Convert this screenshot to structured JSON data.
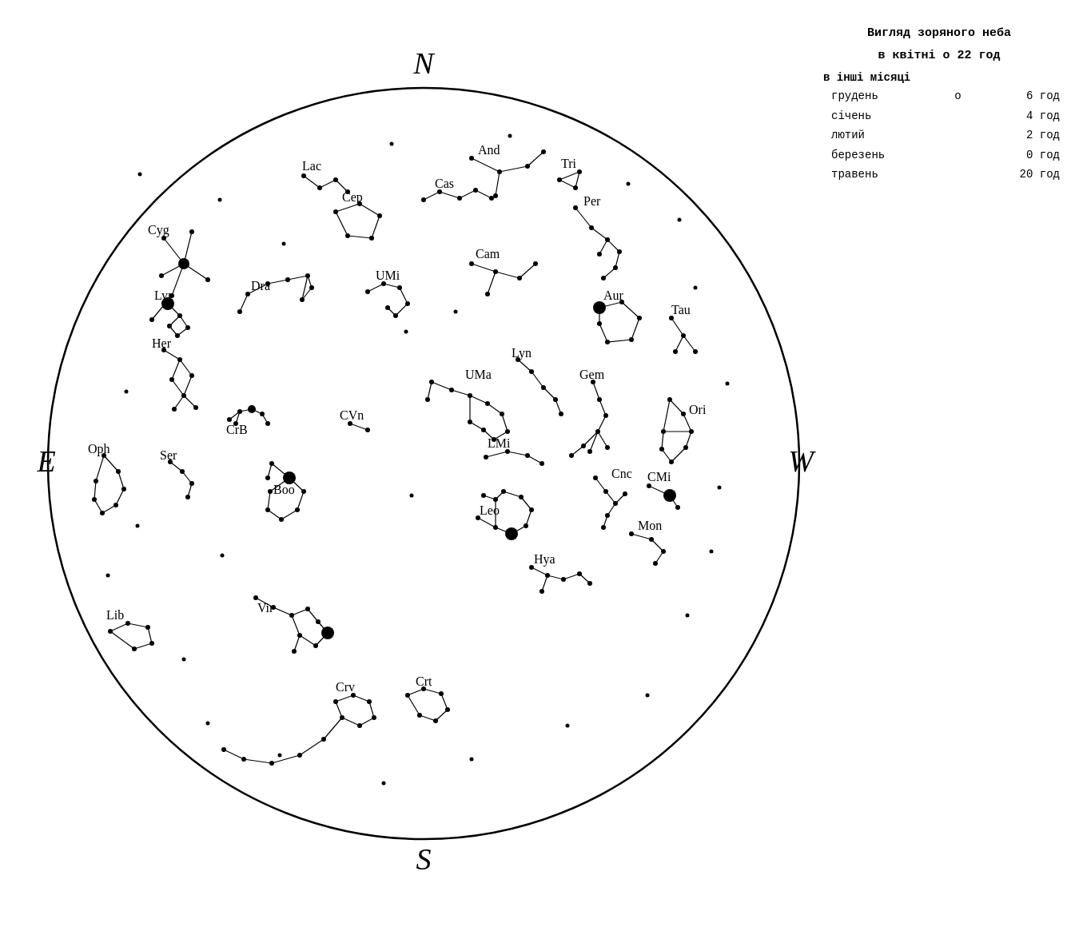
{
  "title": "Вигляд зоряного неба",
  "subtitle": "в квітні о 22 год",
  "subtitle2": "в інші місяці",
  "months": [
    {
      "name": "грудень",
      "hour": "6 год"
    },
    {
      "name": "січень",
      "hour": "4 год"
    },
    {
      "name": "лютий",
      "hour": "2 год"
    },
    {
      "name": "березень",
      "hour": "0 год"
    },
    {
      "name": "травень",
      "hour": "20 год"
    }
  ],
  "directions": {
    "N": "N",
    "S": "S",
    "E": "E",
    "W": "W"
  },
  "constellations": [
    "Lac",
    "And",
    "Tri",
    "Per",
    "Cam",
    "Aur",
    "Tau",
    "Ori",
    "CMi",
    "Mon",
    "Hya",
    "Crt",
    "Crv",
    "Leo",
    "Cnc",
    "Gem",
    "Lyn",
    "LMi",
    "CVn",
    "UMa",
    "UMi",
    "Dra",
    "Cep",
    "Cas",
    "Cyg",
    "Lyr",
    "Her",
    "CrB",
    "Boo",
    "Ser",
    "Oph",
    "Vir",
    "Lib",
    "Crt"
  ]
}
